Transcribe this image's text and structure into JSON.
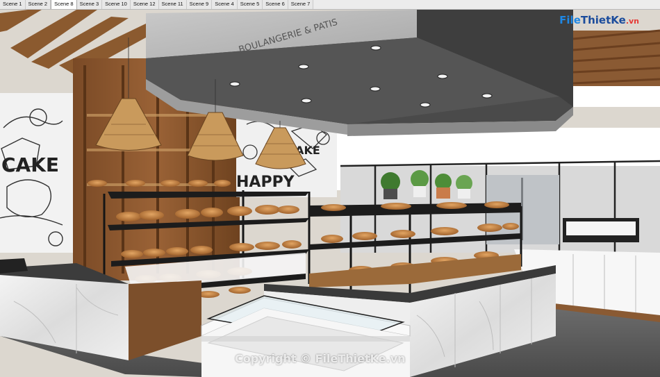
{
  "tabs": [
    {
      "label": "Scene 1",
      "active": false
    },
    {
      "label": "Scene 2",
      "active": false
    },
    {
      "label": "Scene 8",
      "active": true
    },
    {
      "label": "Scene 3",
      "active": false
    },
    {
      "label": "Scene 10",
      "active": false
    },
    {
      "label": "Scene 12",
      "active": false
    },
    {
      "label": "Scene 11",
      "active": false
    },
    {
      "label": "Scene 9",
      "active": false
    },
    {
      "label": "Scene 4",
      "active": false
    },
    {
      "label": "Scene 5",
      "active": false
    },
    {
      "label": "Scene 6",
      "active": false
    },
    {
      "label": "Scene 7",
      "active": false
    }
  ],
  "watermark": {
    "logo_file": "File",
    "logo_thiet": "ThietKe",
    "logo_dot": ".vn",
    "copyright": "Copyright © FileThietKe.vn"
  },
  "scene": {
    "sign_text": "BOULANGERIE & PATIS",
    "mural_words": [
      "CAKE",
      "HAPPY",
      "YAKE"
    ]
  }
}
